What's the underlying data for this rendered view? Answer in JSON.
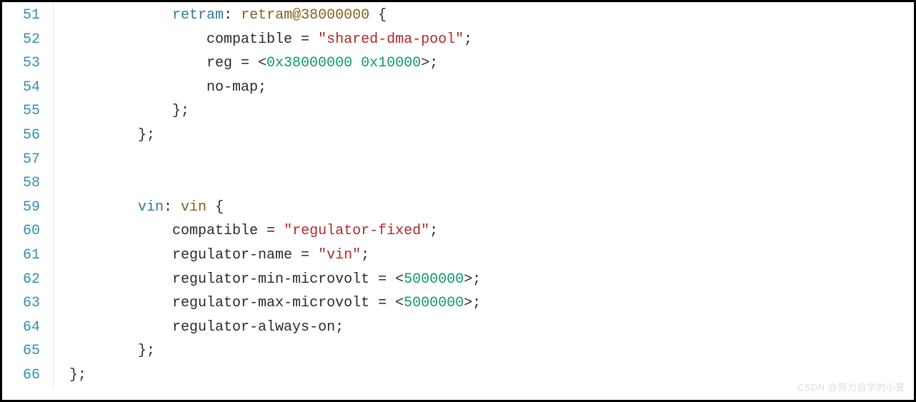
{
  "lines": [
    {
      "num": 51,
      "indent": "            ",
      "tokens": [
        {
          "t": "retram",
          "c": "tok-label"
        },
        {
          "t": ": ",
          "c": "tok-punct"
        },
        {
          "t": "retram@38000000",
          "c": "tok-ident"
        },
        {
          "t": " {",
          "c": "tok-punct"
        }
      ]
    },
    {
      "num": 52,
      "indent": "                ",
      "tokens": [
        {
          "t": "compatible = ",
          "c": "tok-punct"
        },
        {
          "t": "\"shared-dma-pool\"",
          "c": "tok-string"
        },
        {
          "t": ";",
          "c": "tok-punct"
        }
      ]
    },
    {
      "num": 53,
      "indent": "                ",
      "tokens": [
        {
          "t": "reg = <",
          "c": "tok-punct"
        },
        {
          "t": "0x38000000",
          "c": "tok-number"
        },
        {
          "t": " ",
          "c": "tok-punct"
        },
        {
          "t": "0x10000",
          "c": "tok-number"
        },
        {
          "t": ">;",
          "c": "tok-punct"
        }
      ]
    },
    {
      "num": 54,
      "indent": "                ",
      "tokens": [
        {
          "t": "no-map;",
          "c": "tok-punct"
        }
      ]
    },
    {
      "num": 55,
      "indent": "            ",
      "tokens": [
        {
          "t": "};",
          "c": "tok-punct"
        }
      ]
    },
    {
      "num": 56,
      "indent": "        ",
      "tokens": [
        {
          "t": "};",
          "c": "tok-punct"
        }
      ]
    },
    {
      "num": 57,
      "indent": "",
      "tokens": []
    },
    {
      "num": 58,
      "indent": "",
      "tokens": []
    },
    {
      "num": 59,
      "indent": "        ",
      "tokens": [
        {
          "t": "vin",
          "c": "tok-label"
        },
        {
          "t": ": ",
          "c": "tok-punct"
        },
        {
          "t": "vin ",
          "c": "tok-ident"
        },
        {
          "t": "{",
          "c": "tok-punct"
        }
      ]
    },
    {
      "num": 60,
      "indent": "            ",
      "tokens": [
        {
          "t": "compatible = ",
          "c": "tok-punct"
        },
        {
          "t": "\"regulator-fixed\"",
          "c": "tok-string"
        },
        {
          "t": ";",
          "c": "tok-punct"
        }
      ]
    },
    {
      "num": 61,
      "indent": "            ",
      "tokens": [
        {
          "t": "regulator-name = ",
          "c": "tok-punct"
        },
        {
          "t": "\"vin\"",
          "c": "tok-string"
        },
        {
          "t": ";",
          "c": "tok-punct"
        }
      ]
    },
    {
      "num": 62,
      "indent": "            ",
      "tokens": [
        {
          "t": "regulator-min-microvolt = <",
          "c": "tok-punct"
        },
        {
          "t": "5000000",
          "c": "tok-number"
        },
        {
          "t": ">;",
          "c": "tok-punct"
        }
      ]
    },
    {
      "num": 63,
      "indent": "            ",
      "tokens": [
        {
          "t": "regulator-max-microvolt = <",
          "c": "tok-punct"
        },
        {
          "t": "5000000",
          "c": "tok-number"
        },
        {
          "t": ">;",
          "c": "tok-punct"
        }
      ]
    },
    {
      "num": 64,
      "indent": "            ",
      "tokens": [
        {
          "t": "regulator-always-on;",
          "c": "tok-punct"
        }
      ]
    },
    {
      "num": 65,
      "indent": "        ",
      "tokens": [
        {
          "t": "};",
          "c": "tok-punct"
        }
      ]
    },
    {
      "num": 66,
      "indent": "",
      "tokens": [
        {
          "t": "};",
          "c": "tok-punct"
        }
      ]
    }
  ],
  "watermark": "CSDN @努力自学的小夏"
}
